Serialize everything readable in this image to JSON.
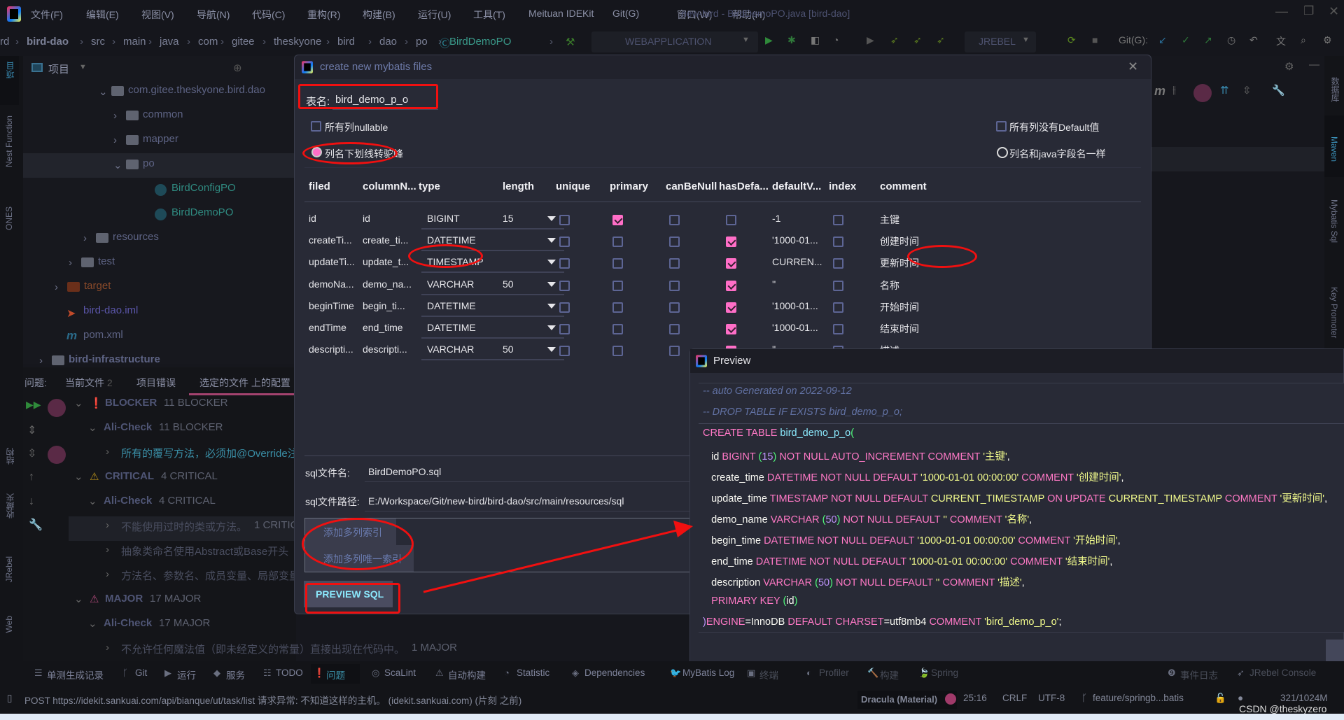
{
  "window": {
    "title": "new-bird - BirdDemoPO.java [bird-dao]",
    "menu": [
      "文件(F)",
      "编辑(E)",
      "视图(V)",
      "导航(N)",
      "代码(C)",
      "重构(R)",
      "构建(B)",
      "运行(U)",
      "工具(T)",
      "Meituan IDEKit",
      "Git(G)",
      "窗口(W)",
      "帮助(H)"
    ]
  },
  "breadcrumb": [
    "rd",
    "bird-dao",
    "src",
    "main",
    "java",
    "com",
    "gitee",
    "theskyone",
    "bird",
    "dao",
    "po",
    "BirdDemoPO"
  ],
  "toolbar": {
    "run_config": "WEBAPPLICATION",
    "jrebel": "JREBEL",
    "git_label": "Git(G):"
  },
  "left_bar": {
    "items": [
      "项目",
      "Nest Function",
      "ONES",
      "结构",
      "收藏夹",
      "JRebel",
      "Web"
    ]
  },
  "right_bar": {
    "items": [
      "数据库",
      "Maven",
      "Mybatis Sql",
      "Key Promoter"
    ]
  },
  "project": {
    "title": "项目",
    "tree": [
      {
        "label": "com.gitee.theskyone.bird.dao",
        "kind": "package",
        "expanded": true
      },
      {
        "label": "common",
        "kind": "package"
      },
      {
        "label": "mapper",
        "kind": "package"
      },
      {
        "label": "po",
        "kind": "package",
        "expanded": true,
        "selected": true
      },
      {
        "label": "BirdConfigPO",
        "kind": "class"
      },
      {
        "label": "BirdDemoPO",
        "kind": "class"
      },
      {
        "label": "resources",
        "kind": "resources"
      },
      {
        "label": "test",
        "kind": "folder"
      },
      {
        "label": "target",
        "kind": "excluded"
      },
      {
        "label": "bird-dao.iml",
        "kind": "iml"
      },
      {
        "label": "pom.xml",
        "kind": "maven"
      },
      {
        "label": "bird-infrastructure",
        "kind": "module"
      }
    ]
  },
  "problems": {
    "label": "问题:",
    "tabs": [
      {
        "label": "当前文件",
        "count": "2"
      },
      {
        "label": "项目错误"
      },
      {
        "label": "选定的文件 上的配置",
        "active": true
      }
    ],
    "items": [
      {
        "title": "BLOCKER",
        "sub": "11 BLOCKER",
        "level": "blocker"
      },
      {
        "title": "Ali-Check",
        "sub": "11 BLOCKER"
      },
      {
        "title": "所有的覆写方法，必须加@Override注",
        "selected": true
      },
      {
        "title": "CRITICAL",
        "sub": "4 CRITICAL",
        "level": "critical"
      },
      {
        "title": "Ali-Check",
        "sub": "4 CRITICAL"
      },
      {
        "title": "不能使用过时的类或方法。",
        "sub": "1 CRITICA"
      },
      {
        "title": "抽象类命名使用Abstract或Base开头"
      },
      {
        "title": "方法名、参数名、成员变量、局部变量"
      },
      {
        "title": "MAJOR",
        "sub": "17 MAJOR",
        "level": "major"
      },
      {
        "title": "Ali-Check",
        "sub": "17 MAJOR"
      },
      {
        "title": "不允许任何魔法值（即未经定义的常量）直接出现在代码中。",
        "sub": "1 MAJOR"
      }
    ]
  },
  "dialog": {
    "title": "create new mybatis files",
    "table_name_label": "表名:",
    "table_name": "bird_demo_p_o",
    "all_nullable": {
      "label": "所有列nullable",
      "checked": false
    },
    "no_default": {
      "label": "所有列没有Default值",
      "checked": false
    },
    "radio_camel": {
      "label": "列名下划线转驼峰",
      "checked": true
    },
    "radio_same": {
      "label": "列名和java字段名一样",
      "checked": false
    },
    "columns": [
      "filed",
      "columnN...",
      "type",
      "length",
      "unique",
      "primary",
      "canBeNull",
      "hasDefa...",
      "defaultV...",
      "index",
      "comment"
    ],
    "rows": [
      {
        "filed": "id",
        "column": "id",
        "type": "BIGINT",
        "length": "15",
        "unique": false,
        "primary": true,
        "canBeNull": false,
        "hasDefault": false,
        "default": "-1",
        "index": false,
        "comment": "主键"
      },
      {
        "filed": "createTi...",
        "column": "create_ti...",
        "type": "DATETIME",
        "length": "",
        "unique": false,
        "primary": false,
        "canBeNull": false,
        "hasDefault": true,
        "default": "'1000-01...",
        "index": false,
        "comment": "创建时间"
      },
      {
        "filed": "updateTi...",
        "column": "update_t...",
        "type": "TIMESTAMP",
        "length": "",
        "unique": false,
        "primary": false,
        "canBeNull": false,
        "hasDefault": true,
        "default": "CURREN...",
        "index": false,
        "comment": "更新时间"
      },
      {
        "filed": "demoNa...",
        "column": "demo_na...",
        "type": "VARCHAR",
        "length": "50",
        "unique": false,
        "primary": false,
        "canBeNull": false,
        "hasDefault": true,
        "default": "''",
        "index": false,
        "comment": "名称"
      },
      {
        "filed": "beginTime",
        "column": "begin_ti...",
        "type": "DATETIME",
        "length": "",
        "unique": false,
        "primary": false,
        "canBeNull": false,
        "hasDefault": true,
        "default": "'1000-01...",
        "index": false,
        "comment": "开始时间"
      },
      {
        "filed": "endTime",
        "column": "end_time",
        "type": "DATETIME",
        "length": "",
        "unique": false,
        "primary": false,
        "canBeNull": false,
        "hasDefault": true,
        "default": "'1000-01...",
        "index": false,
        "comment": "结束时间"
      },
      {
        "filed": "descripti...",
        "column": "descripti...",
        "type": "VARCHAR",
        "length": "50",
        "unique": false,
        "primary": false,
        "canBeNull": false,
        "hasDefault": true,
        "default": "''",
        "index": false,
        "comment": "描述"
      }
    ],
    "sql_file_name_label": "sql文件名:",
    "sql_file_name": "BirdDemoPO.sql",
    "sql_file_path_label": "sql文件路径:",
    "sql_file_path": "E:/Workspace/Git/new-bird/bird-dao/src/main/resources/sql",
    "add_index": "添加多列索引",
    "add_unique_index": "添加多列唯一索引",
    "preview_button": "PREVIEW SQL"
  },
  "preview": {
    "title": "Preview",
    "lines": [
      [
        [
          "-- auto Generated on 2022-09-12",
          "c"
        ]
      ],
      [
        [
          "-- DROP TABLE IF EXISTS bird_demo_p_o;",
          "c"
        ]
      ],
      [
        [
          "CREATE TABLE ",
          "k"
        ],
        [
          "bird_demo_p_o",
          "cy"
        ],
        [
          "(",
          "p"
        ]
      ],
      [
        [
          "   id ",
          "i"
        ],
        [
          "BIGINT ",
          "k"
        ],
        [
          "(",
          "p"
        ],
        [
          "15",
          "n"
        ],
        [
          ")",
          "p"
        ],
        [
          " NOT NULL AUTO_INCREMENT COMMENT ",
          "k"
        ],
        [
          "'主键'",
          "s"
        ],
        [
          ",",
          "i"
        ]
      ],
      [
        [
          "   create_time ",
          "i"
        ],
        [
          "DATETIME NOT NULL DEFAULT ",
          "k"
        ],
        [
          "'1000-01-01 00:00:00'",
          "s"
        ],
        [
          " COMMENT ",
          "k"
        ],
        [
          "'创建时间'",
          "s"
        ],
        [
          ",",
          "i"
        ]
      ],
      [
        [
          "   update_time ",
          "i"
        ],
        [
          "TIMESTAMP NOT NULL DEFAULT ",
          "k"
        ],
        [
          "CURRENT_TIMESTAMP",
          "s"
        ],
        [
          " ON UPDATE ",
          "k"
        ],
        [
          "CURRENT_TIMESTAMP",
          "s"
        ],
        [
          " COMMENT ",
          "k"
        ],
        [
          "'更新时间'",
          "s"
        ],
        [
          ",",
          "i"
        ]
      ],
      [
        [
          "   demo_name ",
          "i"
        ],
        [
          "VARCHAR ",
          "k"
        ],
        [
          "(",
          "p"
        ],
        [
          "50",
          "n"
        ],
        [
          ")",
          "p"
        ],
        [
          " NOT NULL DEFAULT ",
          "k"
        ],
        [
          "'' ",
          "s"
        ],
        [
          "COMMENT ",
          "k"
        ],
        [
          "'名称'",
          "s"
        ],
        [
          ",",
          "i"
        ]
      ],
      [
        [
          "   begin_time ",
          "i"
        ],
        [
          "DATETIME NOT NULL DEFAULT ",
          "k"
        ],
        [
          "'1000-01-01 00:00:00'",
          "s"
        ],
        [
          " COMMENT ",
          "k"
        ],
        [
          "'开始时间'",
          "s"
        ],
        [
          ",",
          "i"
        ]
      ],
      [
        [
          "   end_time ",
          "i"
        ],
        [
          "DATETIME NOT NULL DEFAULT ",
          "k"
        ],
        [
          "'1000-01-01 00:00:00'",
          "s"
        ],
        [
          " COMMENT ",
          "k"
        ],
        [
          "'结束时间'",
          "s"
        ],
        [
          ",",
          "i"
        ]
      ],
      [
        [
          "   description ",
          "i"
        ],
        [
          "VARCHAR ",
          "k"
        ],
        [
          "(",
          "p"
        ],
        [
          "50",
          "n"
        ],
        [
          ")",
          "p"
        ],
        [
          " NOT NULL DEFAULT ",
          "k"
        ],
        [
          "'' ",
          "s"
        ],
        [
          "COMMENT ",
          "k"
        ],
        [
          "'描述'",
          "s"
        ],
        [
          ",",
          "i"
        ]
      ],
      [
        [
          "   PRIMARY KEY ",
          "k"
        ],
        [
          "(",
          "p"
        ],
        [
          "id",
          "i"
        ],
        [
          ")",
          "p"
        ]
      ],
      [
        [
          ")",
          "n"
        ],
        [
          "ENGINE",
          "k"
        ],
        [
          "=InnoDB ",
          "i"
        ],
        [
          "DEFAULT CHARSET",
          "k"
        ],
        [
          "=utf8mb4 ",
          "i"
        ],
        [
          "COMMENT ",
          "k"
        ],
        [
          "'bird_demo_p_o'",
          "s"
        ],
        [
          ";",
          "i"
        ]
      ]
    ]
  },
  "bottom_tools": [
    "单测生成记录",
    "Git",
    "运行",
    "服务",
    "TODO",
    "问题",
    "ScaLint",
    "自动构建",
    "Statistic",
    "Dependencies",
    "MyBatis Log",
    "终端",
    "Profiler",
    "构建",
    "Spring",
    "事件日志",
    "JRebel Console"
  ],
  "status": {
    "message": "POST https://idekit.sankuai.com/api/bianque/ut/task/list 请求异常: 不知道这样的主机。 (idekit.sankuai.com) (片刻 之前)",
    "theme": "Dracula (Material)",
    "position": "25:16",
    "line_sep": "CRLF",
    "encoding": "UTF-8",
    "branch": "feature/springb...batis",
    "memory": "321/1024M"
  },
  "watermark": "CSDN @theskyzero",
  "colors": {
    "accent": "#ff79c6",
    "annotation": "#f01010",
    "dialog_bg": "#282a36",
    "string": "#f1fa8c",
    "number": "#bd93f9",
    "paren": "#50fa7b",
    "comment": "#6272a4"
  }
}
